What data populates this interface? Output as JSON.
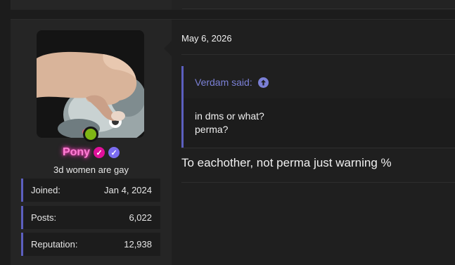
{
  "user": {
    "name": "Pony",
    "title": "3d women are gay",
    "stats": [
      {
        "label": "Joined:",
        "value": "Jan 4, 2024"
      },
      {
        "label": "Posts:",
        "value": "6,022"
      },
      {
        "label": "Reputation:",
        "value": "12,938"
      }
    ],
    "online_color": "#7fb515",
    "name_color": "#ff7fd4"
  },
  "post": {
    "date": "May 6, 2026",
    "quote": {
      "author": "Verdam said:",
      "lines": [
        "in dms or what?",
        "perma?"
      ]
    },
    "message": "To eachother, not perma just warning %"
  },
  "icons": {
    "badge1": "check-badge-icon",
    "badge2": "check-badge-icon",
    "quote_jump": "arrow-up-circle-icon"
  }
}
